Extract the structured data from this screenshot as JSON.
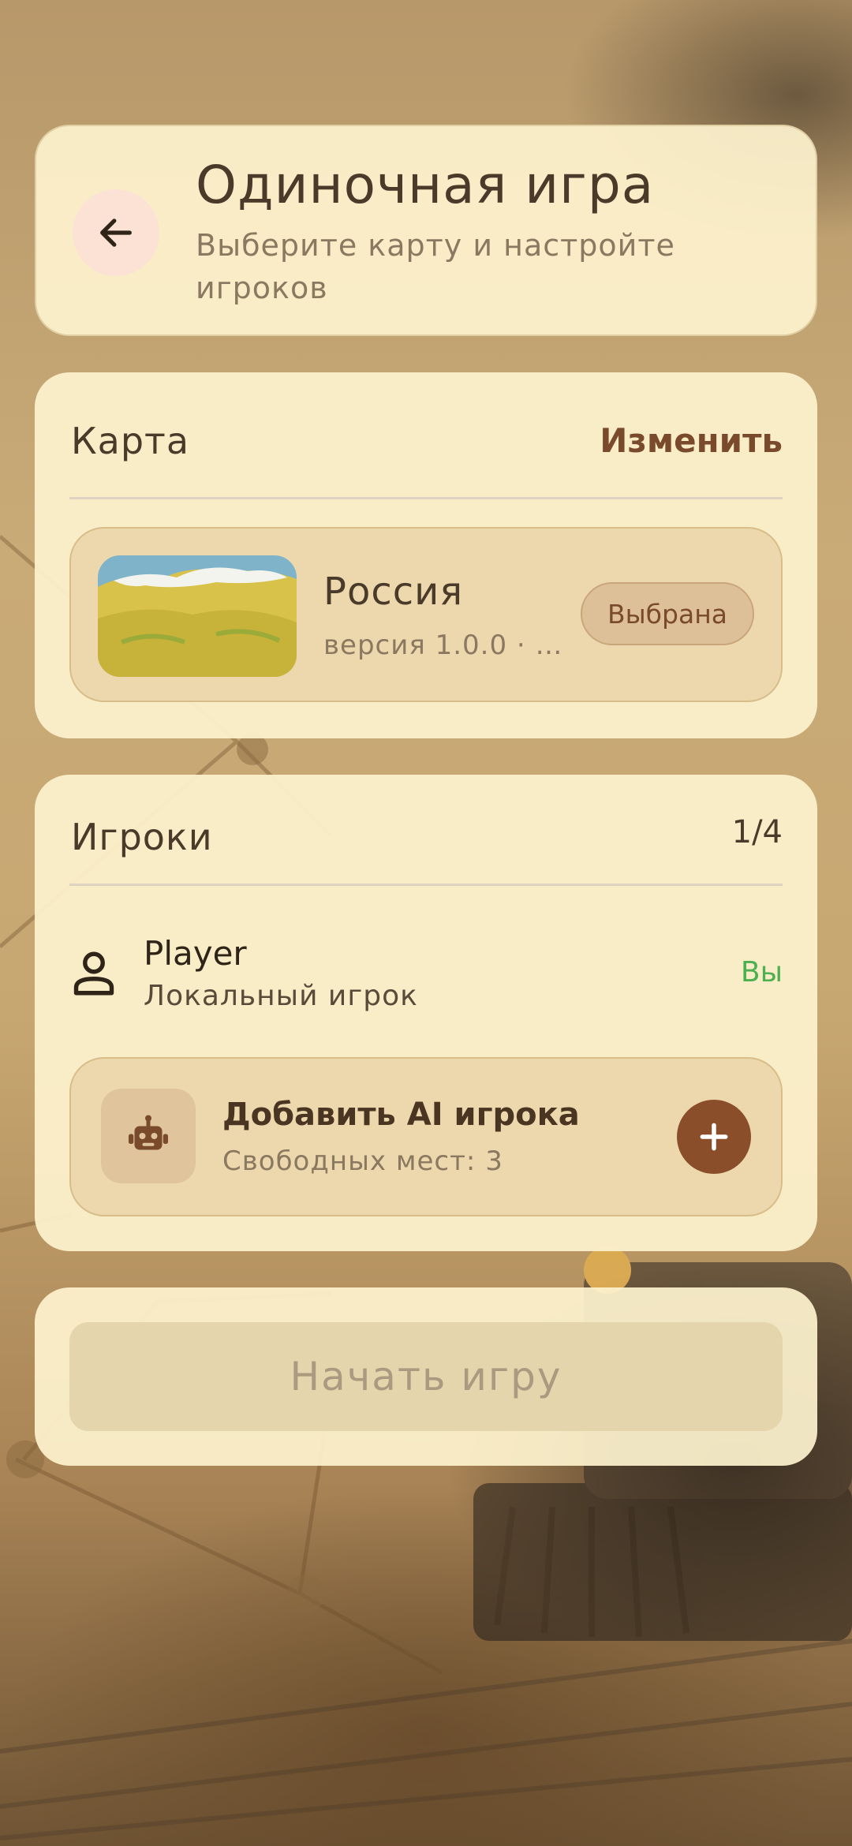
{
  "header": {
    "title": "Одиночная игра",
    "subtitle": "Выберите карту и настройте игроков",
    "back_icon": "arrow-left-icon"
  },
  "map_section": {
    "title": "Карта",
    "change_label": "Изменить",
    "selected_map": {
      "name": "Россия",
      "version": "версия 1.0.0 · ав...",
      "status": "Выбрана"
    }
  },
  "players_section": {
    "title": "Игроки",
    "count": "1/4",
    "players": [
      {
        "name": "Player",
        "type": "Локальный игрок",
        "badge": "Вы",
        "icon": "person-icon"
      }
    ],
    "add_ai": {
      "title": "Добавить AI игрока",
      "subtitle": "Свободных мест: 3",
      "icon": "robot-icon",
      "button_icon": "plus-icon"
    }
  },
  "start_button": {
    "label": "Начать игру"
  },
  "colors": {
    "accent": "#8a4e2a",
    "card_bg": "#fdf2cd",
    "text_primary": "#4a3a2a",
    "text_secondary": "#8b7860",
    "you_badge": "#4caf50"
  }
}
